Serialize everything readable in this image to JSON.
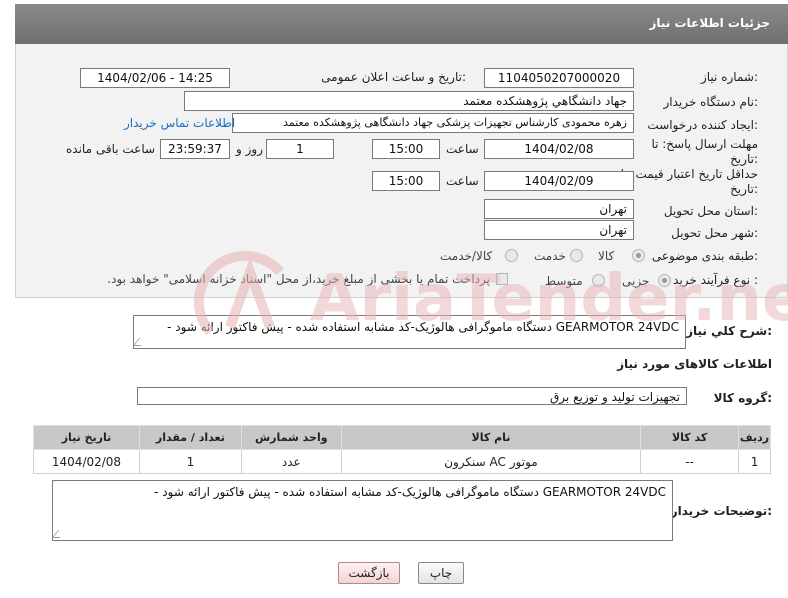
{
  "header": {
    "title": "جزئیات اطلاعات نیاز"
  },
  "form": {
    "need_number": {
      "label": "شماره نیاز:",
      "value": "1104050207000020"
    },
    "announce_datetime": {
      "label": "تاریخ و ساعت اعلان عمومی:",
      "value": "1404/02/06 - 14:25"
    },
    "buyer_org": {
      "label": "نام دستگاه خریدار:",
      "value": "جهاد دانشگاهي پژوهشکده معتمد"
    },
    "requester": {
      "label": "ایجاد کننده درخواست:",
      "value": "زهره محمودی کارشناس تجهیزات پزشکی جهاد دانشگاهی پژوهشکده معتمد",
      "contact_link": "اطلاعات تماس خریدار"
    },
    "reply_deadline": {
      "label": "مهلت ارسال پاسخ: تا تاریخ:",
      "date": "1404/02/08",
      "time_label": "ساعت",
      "time": "15:00",
      "days": "1",
      "days_label": "روز و",
      "remaining": "23:59:37",
      "remaining_label": "ساعت باقی مانده"
    },
    "price_validity": {
      "label": "حداقل تاریخ اعتبار قیمت: تا تاریخ:",
      "date": "1404/02/09",
      "time_label": "ساعت",
      "time": "15:00"
    },
    "delivery_province": {
      "label": "استان محل تحویل:",
      "value": "تهران"
    },
    "delivery_city": {
      "label": "شهر محل تحویل:",
      "value": "تهران"
    },
    "category": {
      "label": "طبقه بندی موضوعی:",
      "options": [
        "کالا",
        "خدمت",
        "کالا/خدمت"
      ],
      "selected": "کالا"
    },
    "process_type": {
      "label": "نوع فرآیند خرید :",
      "options": [
        "جزیی",
        "متوسط"
      ],
      "selected": "جزیی",
      "treasury_note": "پرداخت تمام یا بخشی از مبلغ خرید،از محل \"اسناد خزانه اسلامی\" خواهد بود."
    }
  },
  "summary": {
    "label": "شرح كلي نياز:",
    "value": "GEARMOTOR 24VDC دستگاه ماموگرافی هالوژیک-کد مشابه استفاده شده - پیش فاکتور ارائه شود -"
  },
  "goods_section": {
    "title": "اطلاعات کالاهای مورد نیاز"
  },
  "goods_group": {
    "label": "گروه کالا:",
    "value": "تجهیزات تولید و توزیع برق"
  },
  "table": {
    "headers": [
      "ردیف",
      "کد کالا",
      "نام کالا",
      "واحد شمارش",
      "تعداد / مقدار",
      "تاریخ نیاز"
    ],
    "rows": [
      [
        "1",
        "--",
        "موتور AC سنکرون",
        "عدد",
        "1",
        "1404/02/08"
      ]
    ]
  },
  "buyer_notes": {
    "label": "توضیحات خریدار:",
    "value": "GEARMOTOR 24VDC دستگاه ماموگرافی هالوژیک-کد مشابه استفاده شده - پیش فاکتور ارائه شود -"
  },
  "buttons": {
    "print": "چاپ",
    "back": "بازگشت"
  },
  "watermark": {
    "text": "AriaTender.neT"
  },
  "colors": {
    "header_bg": "#7a7a7a",
    "link": "#1a6fc0",
    "watermark": "#e7b3b3"
  }
}
